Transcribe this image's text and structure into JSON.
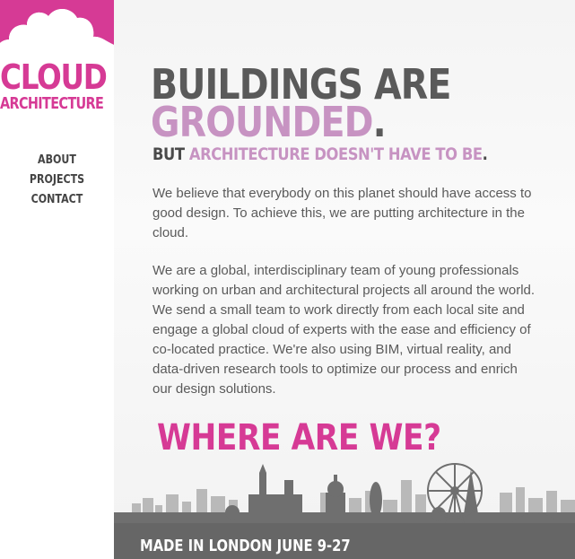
{
  "logo": {
    "line1": "CLOUD",
    "line2": "ARCHITECTURE",
    "icon": "cloud-icon",
    "brand_color": "#d63a95"
  },
  "nav": {
    "items": [
      {
        "label": "ABOUT"
      },
      {
        "label": "PROJECTS"
      },
      {
        "label": "CONTACT"
      }
    ]
  },
  "hero": {
    "line1": "BUILDINGS ARE",
    "line2": "GROUNDED",
    "line2_dot": ".",
    "sub_dark": "BUT ",
    "sub_pink": "ARCHITECTURE DOESN'T HAVE TO BE",
    "sub_dot": "."
  },
  "paragraphs": [
    "We believe that everybody on this planet should have access to good design. To achieve this, we are putting architecture in the cloud.",
    "We are a global, interdisciplinary team of young professionals working on urban and architectural projects all around the world. We send a small team to work directly from each local site and engage a global cloud of experts with the ease and efficiency of co-located practice. We're also using BIM, virtual reality, and data-driven research tools to optimize our process and enrich our design solutions."
  ],
  "where_heading": "WHERE ARE WE?",
  "footer": {
    "text": "MADE IN LONDON JUNE 9-27",
    "illustration": "london-skyline"
  },
  "colors": {
    "accent_pink": "#d63a95",
    "soft_pink": "#c793c2",
    "heading_gray": "#5a5a5a",
    "skyline_dark": "#666666",
    "skyline_light": "#b5b5b5"
  }
}
